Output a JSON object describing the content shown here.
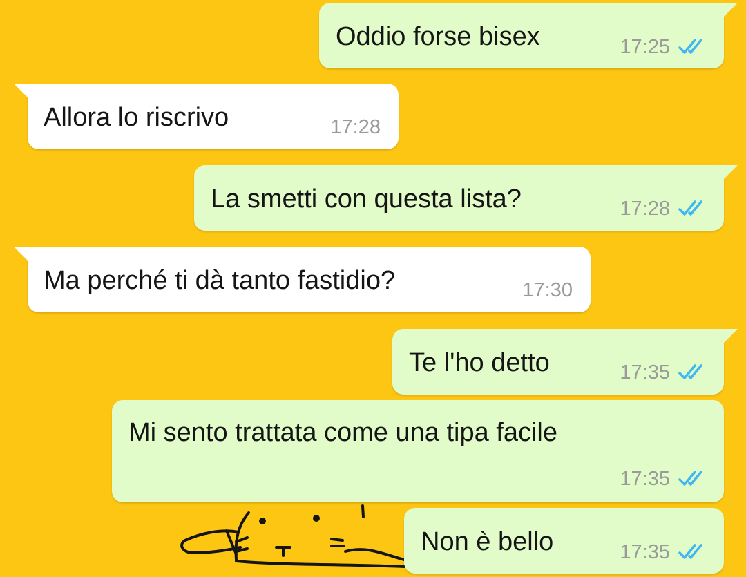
{
  "colors": {
    "wallpaper": "#fdc613",
    "outgoing_bubble": "#e1fcc9",
    "incoming_bubble": "#ffffff",
    "read_ticks": "#3fb7f0",
    "timestamp": "#9a9a9a"
  },
  "messages": [
    {
      "direction": "out",
      "text": "Oddio forse bisex",
      "time": "17:25",
      "status": "read"
    },
    {
      "direction": "in",
      "text": "Allora lo riscrivo",
      "time": "17:28"
    },
    {
      "direction": "out",
      "text": "La smetti con questa lista?",
      "time": "17:28",
      "status": "read"
    },
    {
      "direction": "in",
      "text": "Ma perché ti dà tanto fastidio?",
      "time": "17:30"
    },
    {
      "direction": "out",
      "text": "Te l'ho detto",
      "time": "17:35",
      "status": "read"
    },
    {
      "direction": "out",
      "text": "Mi sento trattata come una tipa facile",
      "time": "17:35",
      "status": "read"
    },
    {
      "direction": "out",
      "text": "Non è bello",
      "time": "17:35",
      "status": "read"
    }
  ],
  "wallpaper_doodle": "cat-doodle"
}
